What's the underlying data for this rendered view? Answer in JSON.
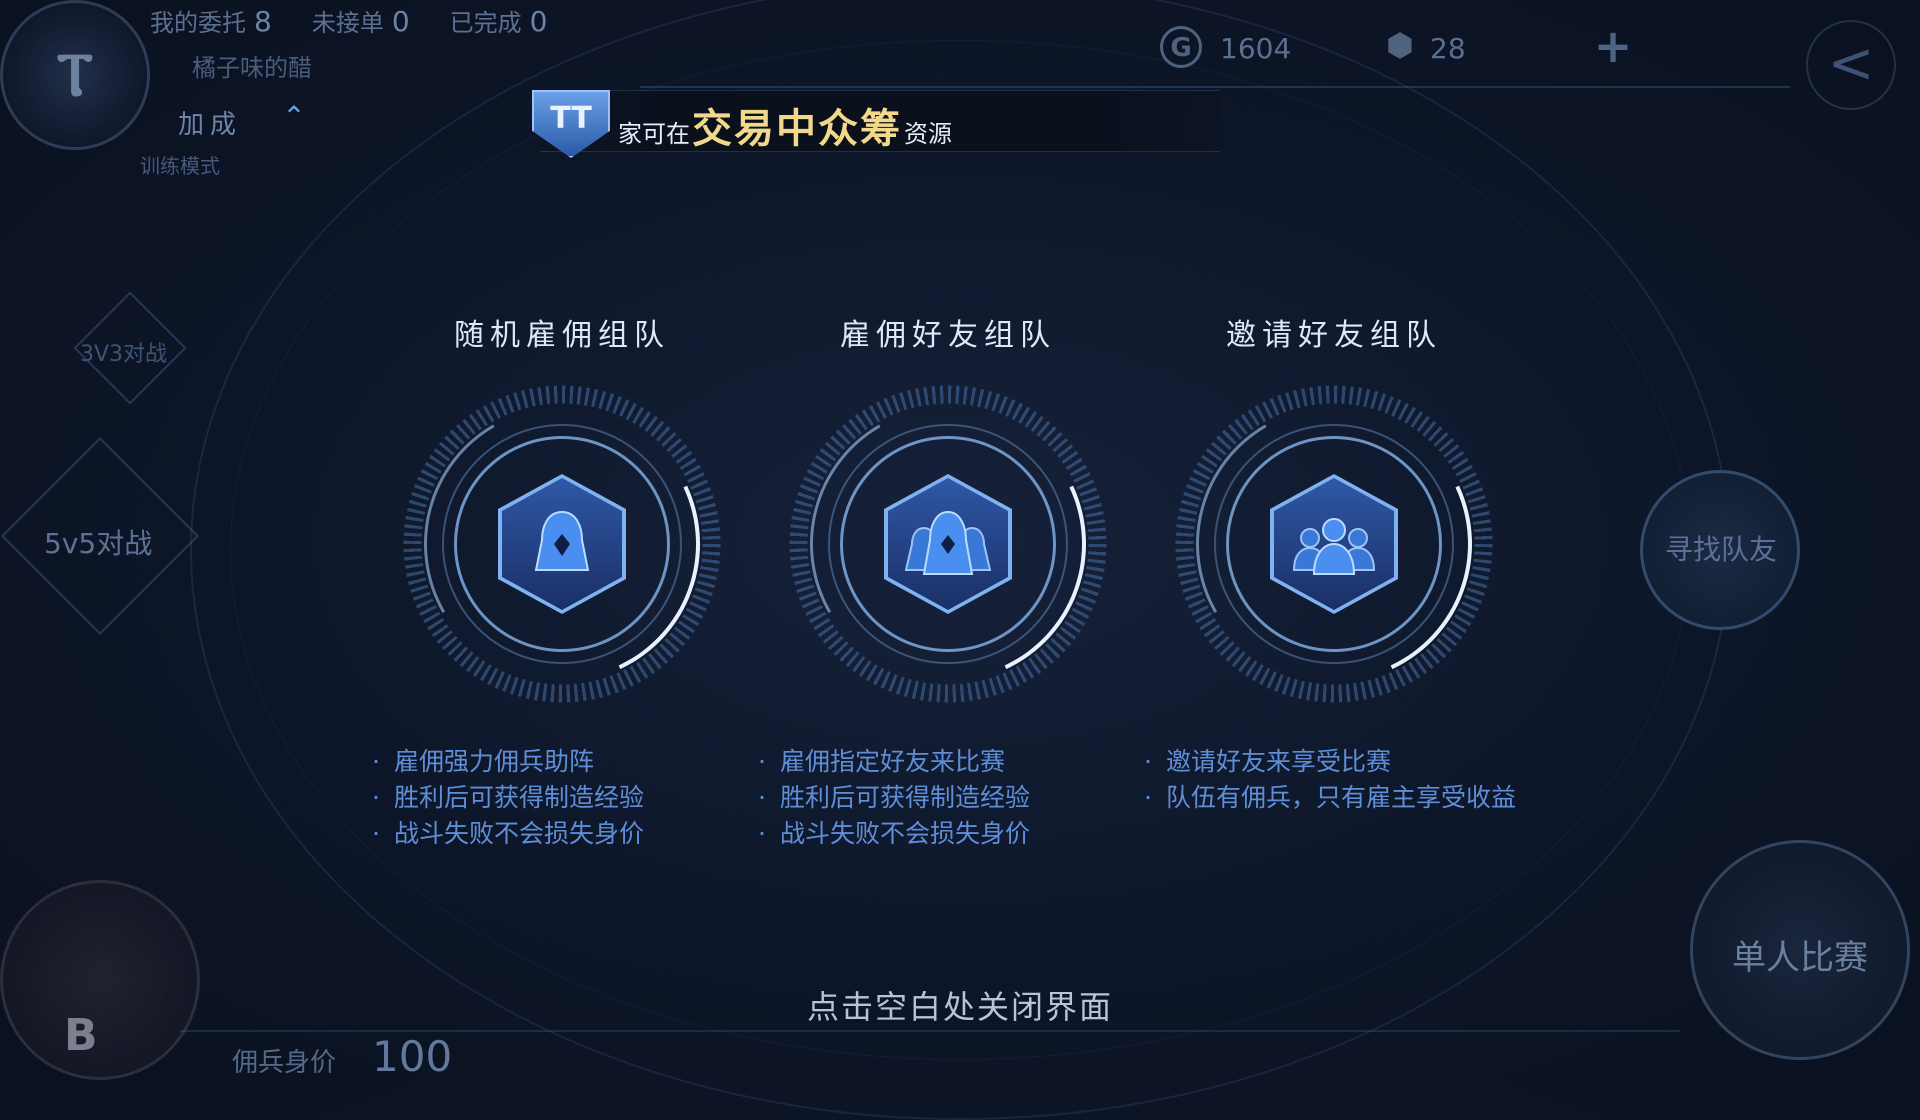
{
  "hud": {
    "my_commission_label": "我的委托",
    "my_commission_count": "8",
    "not_accepted_label": "未接单",
    "not_accepted_count": "0",
    "completed_label": "已完成",
    "completed_count": "0",
    "nickname": "橘子味的醋",
    "bonus_label": "加成",
    "training_mode": "训练模式",
    "mode_3v3": "3V3对战",
    "mode_5v5": "5v5对战",
    "rank_letter": "B",
    "merc_price_label": "佣兵身价",
    "merc_price_value": "100"
  },
  "currency": {
    "gold_icon_letter": "G",
    "gold": "1604",
    "gem": "28",
    "add_symbol": "+",
    "back_symbol": "<"
  },
  "banner": {
    "shield_text": "TT",
    "prefix": "家可在",
    "highlight": "交易中众筹",
    "suffix": "资源"
  },
  "options": [
    {
      "title": "随机雇佣组队",
      "icon": "single-hooded-figure-icon",
      "bullets": [
        "雇佣强力佣兵助阵",
        "胜利后可获得制造经验",
        "战斗失败不会损失身价"
      ]
    },
    {
      "title": "雇佣好友组队",
      "icon": "group-hooded-figures-icon",
      "bullets": [
        "雇佣指定好友来比赛",
        "胜利后可获得制造经验",
        "战斗失败不会损失身价"
      ]
    },
    {
      "title": "邀请好友组队",
      "icon": "group-people-icon",
      "bullets": [
        "邀请好友来享受比赛",
        "队伍有佣兵，只有雇主享受收益"
      ]
    }
  ],
  "right": {
    "find_teammate": "寻找队友",
    "solo_match": "单人比赛"
  },
  "close_hint": "点击空白处关闭界面",
  "colors": {
    "accent_blue": "#5f8ed8",
    "highlight_gold": "#f2d88a",
    "background": "#0d1628"
  }
}
